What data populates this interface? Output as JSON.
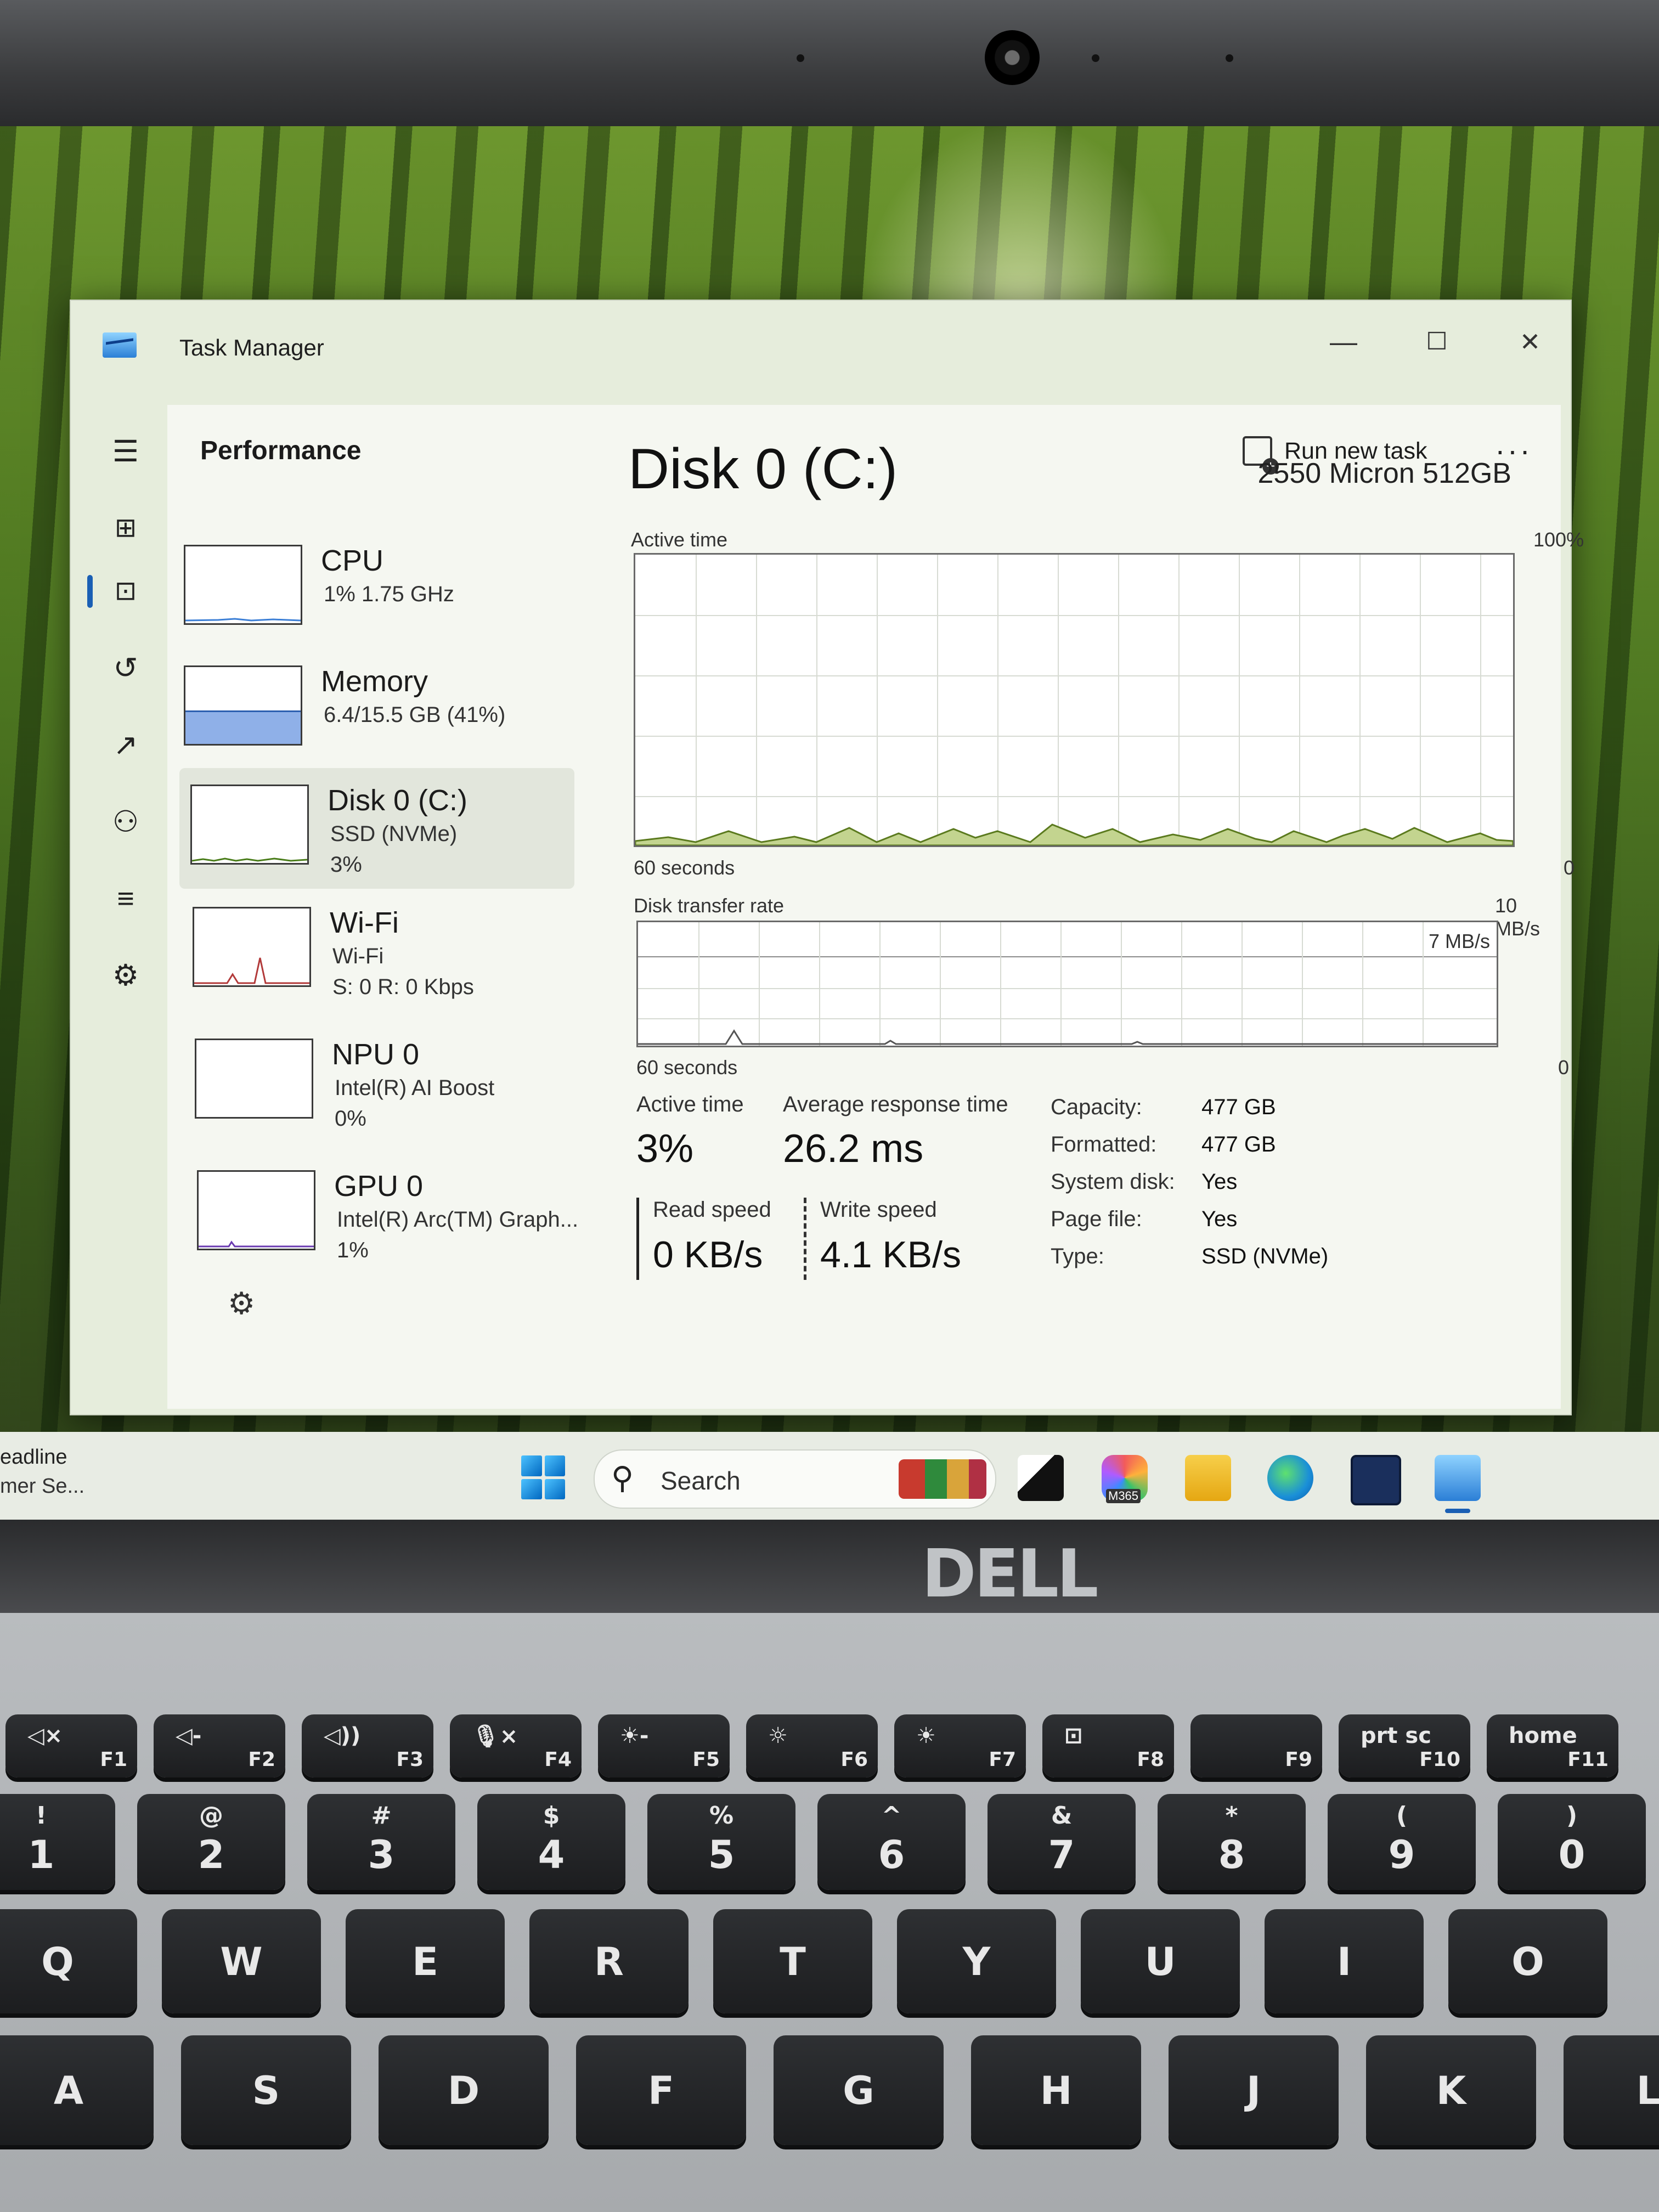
{
  "window": {
    "title": "Task Manager",
    "minimize": "—",
    "maximize": "☐",
    "close": "✕"
  },
  "header": {
    "page_title": "Performance",
    "run_new_task": "Run new task",
    "more": "···"
  },
  "nav_icons": [
    "hamburger-icon",
    "processes-icon",
    "performance-icon",
    "app-history-icon",
    "startup-apps-icon",
    "users-icon",
    "details-icon",
    "services-icon"
  ],
  "resources": [
    {
      "name": "CPU",
      "sub1": "1%  1.75 GHz",
      "sub2": ""
    },
    {
      "name": "Memory",
      "sub1": "6.4/15.5 GB (41%)",
      "sub2": ""
    },
    {
      "name": "Disk 0 (C:)",
      "sub1": "SSD (NVMe)",
      "sub2": "3%"
    },
    {
      "name": "Wi-Fi",
      "sub1": "Wi-Fi",
      "sub2": "S: 0  R: 0 Kbps"
    },
    {
      "name": "NPU 0",
      "sub1": "Intel(R) AI Boost",
      "sub2": "0%"
    },
    {
      "name": "GPU 0",
      "sub1": "Intel(R) Arc(TM) Graph...",
      "sub2": "1%"
    }
  ],
  "detail": {
    "title": "Disk 0 (C:)",
    "model": "2550 Micron 512GB",
    "active_time_graph": {
      "label": "Active time",
      "max": "100%",
      "xlabel": "60 seconds",
      "min": "0"
    },
    "transfer_graph": {
      "label": "Disk transfer rate",
      "max": "10 MB/s",
      "inner": "7 MB/s",
      "xlabel": "60 seconds",
      "min": "0"
    },
    "stats": {
      "active_time_label": "Active time",
      "active_time": "3%",
      "avg_response_label": "Average response time",
      "avg_response": "26.2 ms",
      "read_label": "Read speed",
      "read": "0 KB/s",
      "write_label": "Write speed",
      "write": "4.1 KB/s"
    },
    "props": [
      {
        "k": "Capacity:",
        "v": "477 GB"
      },
      {
        "k": "Formatted:",
        "v": "477 GB"
      },
      {
        "k": "System disk:",
        "v": "Yes"
      },
      {
        "k": "Page file:",
        "v": "Yes"
      },
      {
        "k": "Type:",
        "v": "SSD (NVMe)"
      }
    ]
  },
  "taskbar": {
    "left_line1": "eadline",
    "left_line2": "mer Se...",
    "search_placeholder": "Search",
    "m365_label": "M365"
  },
  "keyboard": {
    "fn_row": [
      {
        "glyph": "◁×",
        "fn": "F1"
      },
      {
        "glyph": "◁-",
        "fn": "F2"
      },
      {
        "glyph": "◁))",
        "fn": "F3"
      },
      {
        "glyph": "🎙×",
        "fn": "F4"
      },
      {
        "glyph": "☀-",
        "fn": "F5"
      },
      {
        "glyph": "☼",
        "fn": "F6"
      },
      {
        "glyph": "☀",
        "fn": "F7"
      },
      {
        "glyph": "⊡",
        "fn": "F8"
      },
      {
        "glyph": "",
        "fn": "F9"
      },
      {
        "glyph": "prt sc",
        "fn": "F10"
      },
      {
        "glyph": "home",
        "fn": "F11"
      }
    ],
    "num_row": [
      {
        "top": "!",
        "main": "1"
      },
      {
        "top": "@",
        "main": "2"
      },
      {
        "top": "#",
        "main": "3"
      },
      {
        "top": "$",
        "main": "4"
      },
      {
        "top": "%",
        "main": "5"
      },
      {
        "top": "^",
        "main": "6"
      },
      {
        "top": "&",
        "main": "7"
      },
      {
        "top": "*",
        "main": "8"
      },
      {
        "top": "(",
        "main": "9"
      },
      {
        "top": ")",
        "main": "0"
      }
    ],
    "q_row": [
      "Q",
      "W",
      "E",
      "R",
      "T",
      "Y",
      "U",
      "I",
      "O"
    ],
    "a_row": [
      "A",
      "S",
      "D",
      "F",
      "G",
      "H",
      "J",
      "K",
      "L"
    ],
    "brand": "DELL"
  }
}
